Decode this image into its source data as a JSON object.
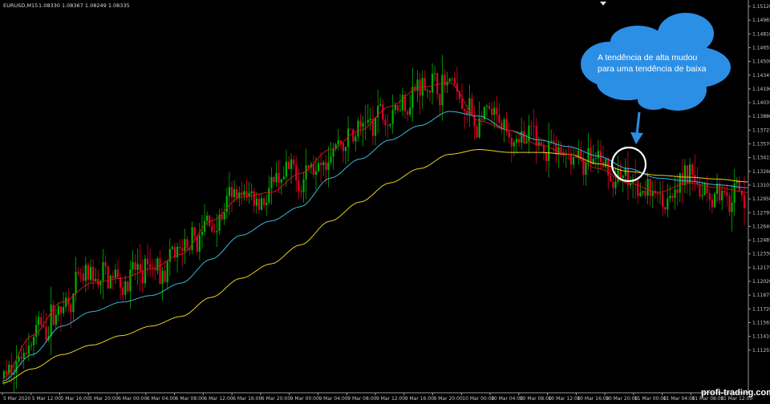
{
  "header": {
    "symbol": "EURUSD,M15",
    "ohlc": "1.08330 1.08367 1.08249 1.08335"
  },
  "price_axis": {
    "labels": [
      "1.15120",
      "1.14965",
      "1.14810",
      "1.14655",
      "1.14500",
      "1.14345",
      "1.14190",
      "1.14035",
      "1.13880",
      "1.13725",
      "1.13570",
      "1.13415",
      "1.13260",
      "1.13105",
      "1.12950",
      "1.12795",
      "1.12640",
      "1.12485",
      "1.12330",
      "1.12175",
      "1.12020",
      "1.11875",
      "1.11720",
      "1.11565",
      "1.11410",
      "1.11255"
    ]
  },
  "time_axis": {
    "labels": [
      "5 Mar 2020",
      "5 Mar 12:00",
      "5 Mar 16:00",
      "5 Mar 20:00",
      "6 Mar 00:00",
      "6 Mar 04:00",
      "6 Mar 08:00",
      "6 Mar 12:00",
      "6 Mar 16:00",
      "6 Mar 20:00",
      "9 Mar 00:00",
      "9 Mar 04:00",
      "9 Mar 08:00",
      "9 Mar 12:00",
      "9 Mar 16:00",
      "9 Mar 20:00",
      "10 Mar 00:00",
      "10 Mar 04:00",
      "10 Mar 08:00",
      "10 Mar 12:00",
      "10 Mar 16:00",
      "10 Mar 20:00",
      "11 Mar 00:00",
      "11 Mar 04:00",
      "11 Mar 08:00",
      "11 Mar 12:00"
    ]
  },
  "annotation": {
    "line1": "A tendência de alta mudou",
    "line2": "para uma tendência de baixa"
  },
  "watermark": "profi-trading.com",
  "colors": {
    "background": "#000000",
    "bull_candle": "#00b000",
    "bear_candle": "#e0002a",
    "ma_fast": "#d01818",
    "ma_mid": "#38b8d8",
    "ma_slow": "#e8d020",
    "bubble": "#2b8fe6",
    "highlight_circle": "#ffffff"
  },
  "chart_data": {
    "type": "line",
    "title": "EURUSD,M15",
    "ylim": [
      1.112,
      1.1525
    ],
    "x": [
      "5 Mar 2020",
      "5 Mar 12:00",
      "5 Mar 16:00",
      "5 Mar 20:00",
      "6 Mar 00:00",
      "6 Mar 04:00",
      "6 Mar 08:00",
      "6 Mar 12:00",
      "6 Mar 16:00",
      "6 Mar 20:00",
      "9 Mar 00:00",
      "9 Mar 04:00",
      "9 Mar 08:00",
      "9 Mar 12:00",
      "9 Mar 16:00",
      "9 Mar 20:00",
      "10 Mar 00:00",
      "10 Mar 04:00",
      "10 Mar 08:00",
      "10 Mar 12:00",
      "10 Mar 16:00",
      "10 Mar 20:00",
      "11 Mar 00:00",
      "11 Mar 04:00",
      "11 Mar 08:00",
      "11 Mar 12:00"
    ],
    "series": [
      {
        "values": [
          1.1135,
          1.118,
          1.1215,
          1.1235,
          1.124,
          1.125,
          1.1265,
          1.13,
          1.1325,
          1.133,
          1.135,
          1.1375,
          1.1395,
          1.142,
          1.144,
          1.1445,
          1.1405,
          1.1395,
          1.138,
          1.137,
          1.1355,
          1.134,
          1.133,
          1.134,
          1.1335,
          1.133
        ]
      },
      {
        "values": [
          1.1132,
          1.116,
          1.119,
          1.1205,
          1.1215,
          1.1222,
          1.1235,
          1.126,
          1.1285,
          1.13,
          1.1315,
          1.1345,
          1.1365,
          1.1385,
          1.14,
          1.1415,
          1.141,
          1.1395,
          1.1385,
          1.1378,
          1.1368,
          1.1355,
          1.1345,
          1.1342,
          1.1338,
          1.1335
        ]
      },
      {
        "values": [
          1.113,
          1.1145,
          1.116,
          1.117,
          1.118,
          1.119,
          1.12,
          1.122,
          1.124,
          1.1255,
          1.1275,
          1.13,
          1.132,
          1.134,
          1.1355,
          1.137,
          1.1375,
          1.1372,
          1.1372,
          1.137,
          1.136,
          1.1352,
          1.1348,
          1.1346,
          1.1344,
          1.1341
        ]
      }
    ]
  }
}
